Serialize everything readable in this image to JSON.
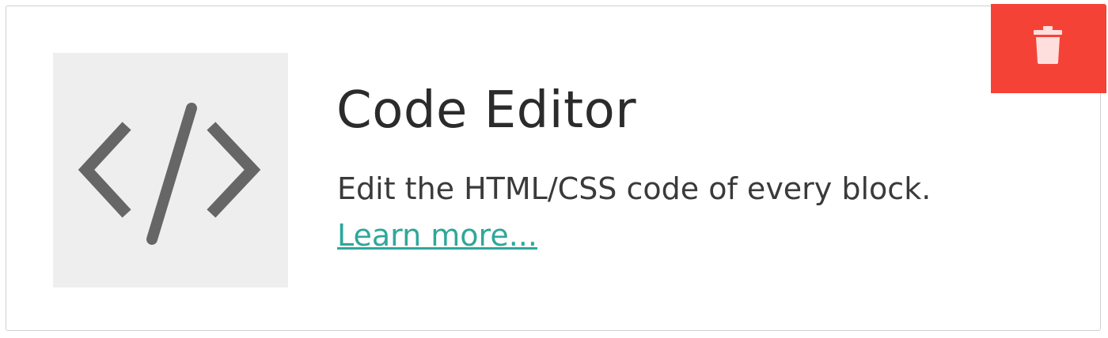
{
  "block": {
    "title": "Code Editor",
    "description": "Edit the HTML/CSS code of every block.",
    "learn_more": "Learn more...",
    "thumbnail_icon": "code-brackets-icon",
    "delete_icon": "trash-icon"
  },
  "colors": {
    "delete_button": "#f44336",
    "link": "#2fa79a",
    "thumbnail_bg": "#eeeeee",
    "icon": "#666666"
  }
}
